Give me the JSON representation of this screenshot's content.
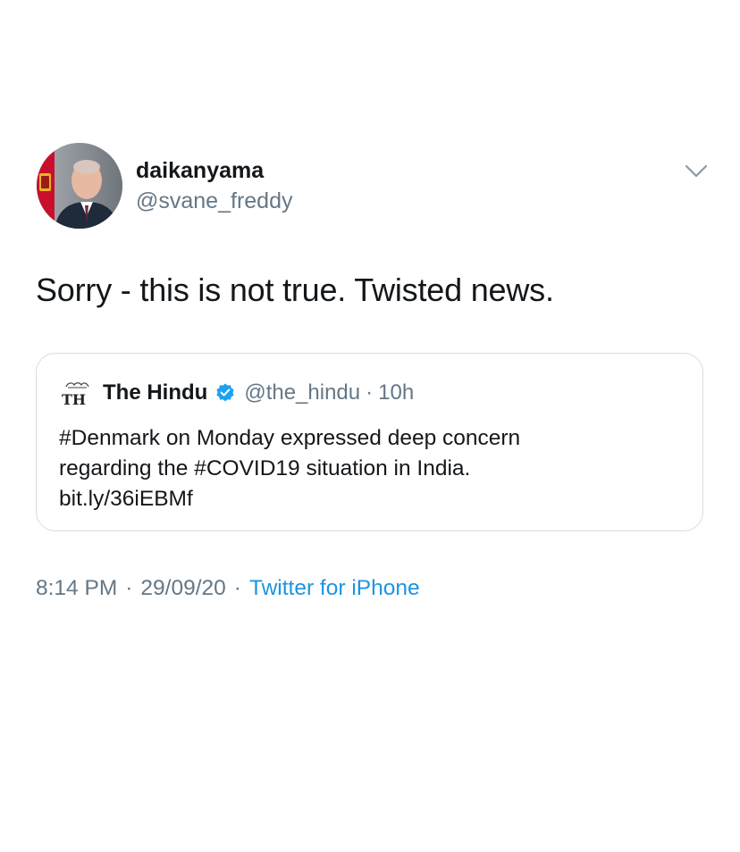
{
  "tweet": {
    "author": {
      "name": "daikanyama",
      "handle": "@svane_freddy"
    },
    "text": "Sorry - this is not true. Twisted news.",
    "quoted": {
      "logo_text": "TH",
      "name": "The Hindu",
      "handle": "@the_hindu",
      "separator": "·",
      "time": "10h",
      "text_lines": [
        "#Denmark on Monday expressed deep concern",
        "regarding the #COVID19 situation in India.",
        "bit.ly/36iEBMf"
      ]
    },
    "meta": {
      "time": "8:14 PM",
      "separator": "·",
      "date": "29/09/20",
      "source": "Twitter for iPhone"
    }
  },
  "colors": {
    "text_primary": "#14171a",
    "text_secondary": "#657786",
    "link_blue": "#1b95e0",
    "verified_blue": "#1da1f2",
    "border": "#d6dde3"
  },
  "icons": {
    "menu": "chevron-down-icon",
    "verified": "verified-badge-icon"
  }
}
